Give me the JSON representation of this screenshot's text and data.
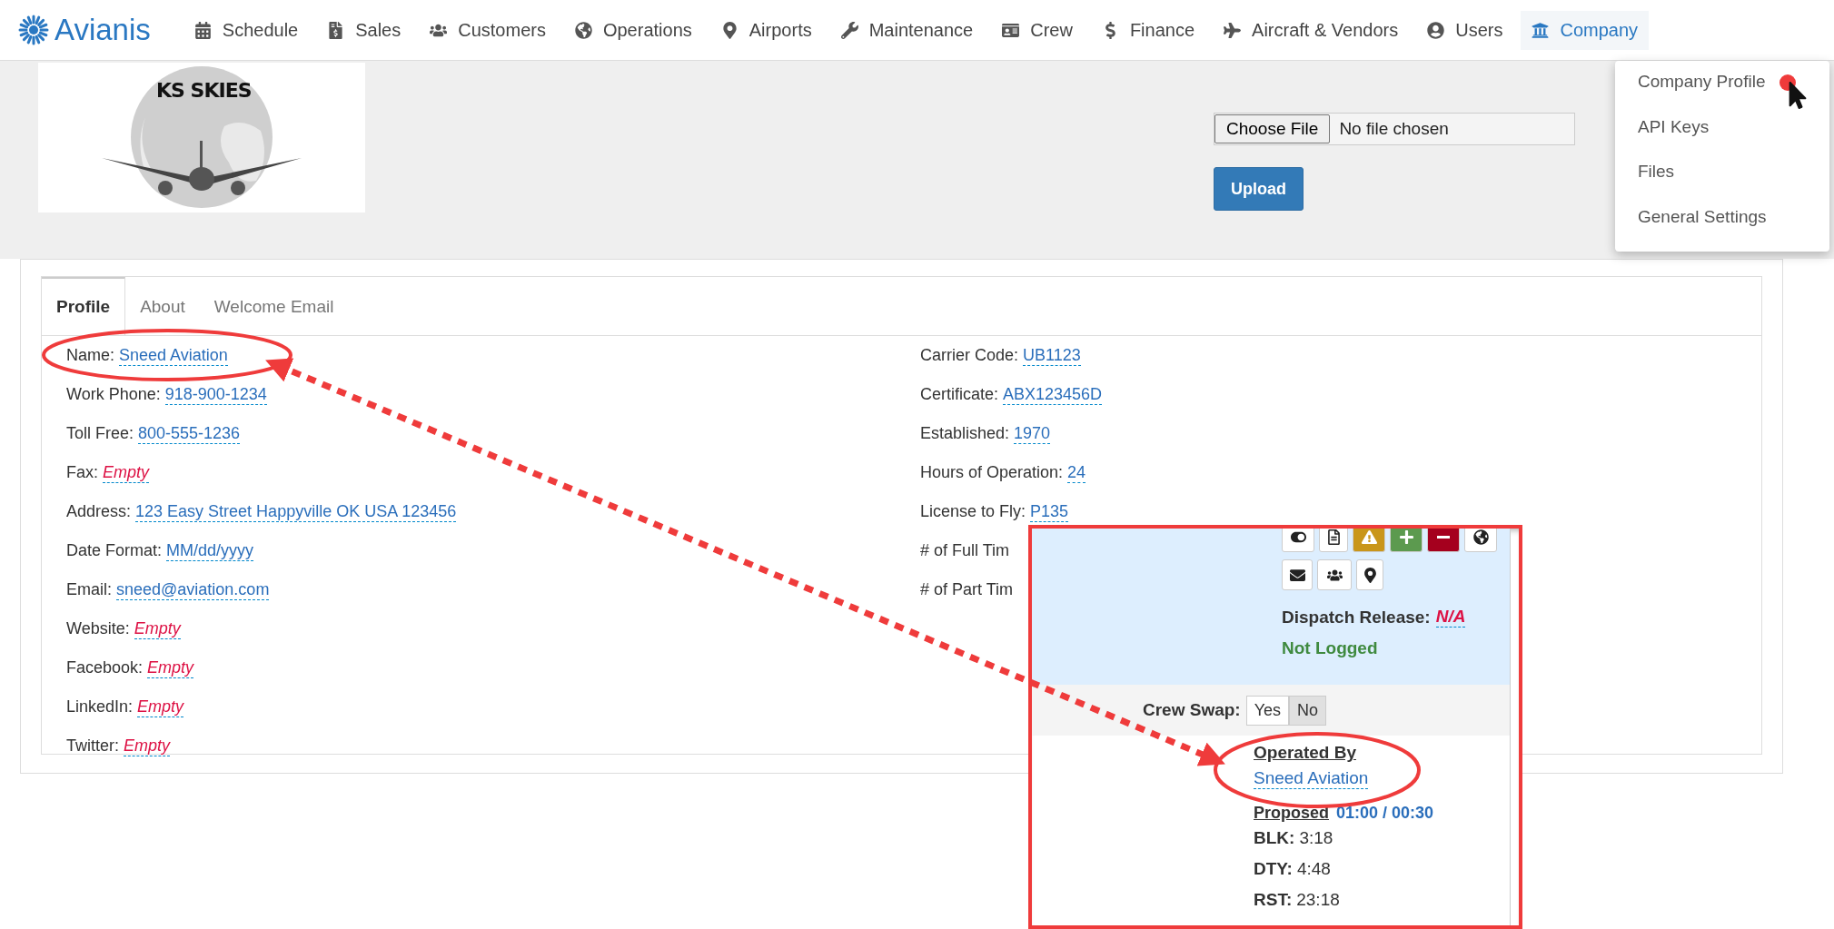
{
  "nav": {
    "brand": "Avianis",
    "items": [
      {
        "label": "Schedule",
        "selected": false
      },
      {
        "label": "Sales",
        "selected": false
      },
      {
        "label": "Customers",
        "selected": false
      },
      {
        "label": "Operations",
        "selected": false
      },
      {
        "label": "Airports",
        "selected": false
      },
      {
        "label": "Maintenance",
        "selected": false
      },
      {
        "label": "Crew",
        "selected": false
      },
      {
        "label": "Finance",
        "selected": false
      },
      {
        "label": "Aircraft & Vendors",
        "selected": false
      },
      {
        "label": "Users",
        "selected": false
      },
      {
        "label": "Company",
        "selected": true
      }
    ]
  },
  "logo": {
    "text": "KS SKIES"
  },
  "file_input": {
    "button": "Choose File",
    "status": "No file chosen"
  },
  "upload_button": "Upload",
  "company_menu": {
    "items": [
      {
        "label": "Company Profile"
      },
      {
        "label": "API Keys"
      },
      {
        "label": "Files"
      },
      {
        "label": "General Settings"
      }
    ]
  },
  "tabs": [
    {
      "label": "Profile",
      "selected": true
    },
    {
      "label": "About",
      "selected": false
    },
    {
      "label": "Welcome Email",
      "selected": false
    }
  ],
  "profile": {
    "left": [
      {
        "label": "Name:",
        "value": "Sneed Aviation",
        "empty": false
      },
      {
        "label": "Work Phone:",
        "value": "918-900-1234",
        "empty": false
      },
      {
        "label": "Toll Free:",
        "value": "800-555-1236",
        "empty": false
      },
      {
        "label": "Fax:",
        "value": "Empty",
        "empty": true
      },
      {
        "label": "Address:",
        "value": "123 Easy Street Happyville OK USA 123456",
        "empty": false
      },
      {
        "label": "Date Format:",
        "value": "MM/dd/yyyy",
        "empty": false
      },
      {
        "label": "Email:",
        "value": "sneed@aviation.com",
        "empty": false
      },
      {
        "label": "Website:",
        "value": "Empty",
        "empty": true
      },
      {
        "label": "Facebook:",
        "value": "Empty",
        "empty": true
      },
      {
        "label": "LinkedIn:",
        "value": "Empty",
        "empty": true
      },
      {
        "label": "Twitter:",
        "value": "Empty",
        "empty": true
      }
    ],
    "right": [
      {
        "label": "Carrier Code:",
        "value": "UB1123",
        "empty": false
      },
      {
        "label": "Certificate:",
        "value": "ABX123456D",
        "empty": false
      },
      {
        "label": "Established:",
        "value": "1970",
        "empty": false
      },
      {
        "label": "Hours of Operation:",
        "value": "24",
        "empty": false
      },
      {
        "label": "License to Fly:",
        "value": "P135",
        "empty": false
      },
      {
        "label": "# of Full Tim"
      },
      {
        "label": "# of Part Tim"
      }
    ]
  },
  "flight_inset": {
    "icon_buttons": [
      {
        "kind": "toggle",
        "color": "#ffffff"
      },
      {
        "kind": "document",
        "color": "#ffffff"
      },
      {
        "kind": "warning",
        "color": "#c9961a"
      },
      {
        "kind": "plus",
        "color": "#5c9a4f"
      },
      {
        "kind": "minus",
        "color": "#a5001e"
      },
      {
        "kind": "globe",
        "color": "#ffffff"
      },
      {
        "kind": "envelope",
        "color": "#ffffff"
      },
      {
        "kind": "users",
        "color": "#ffffff"
      },
      {
        "kind": "pin",
        "color": "#ffffff"
      }
    ],
    "dispatch_release": {
      "label": "Dispatch Release:",
      "value": "N/A"
    },
    "log_status": "Not Logged",
    "crew_swap": {
      "label": "Crew Swap:",
      "options": [
        {
          "label": "Yes",
          "selected": false
        },
        {
          "label": "No",
          "selected": true
        }
      ]
    },
    "operated_by": {
      "heading": "Operated By",
      "value": "Sneed Aviation"
    },
    "proposed": {
      "label": "Proposed",
      "value": "01:00 / 00:30"
    },
    "stats": [
      {
        "label": "BLK:",
        "value": "3:18"
      },
      {
        "label": "DTY:",
        "value": "4:48"
      },
      {
        "label": "RST:",
        "value": "23:18"
      }
    ]
  }
}
